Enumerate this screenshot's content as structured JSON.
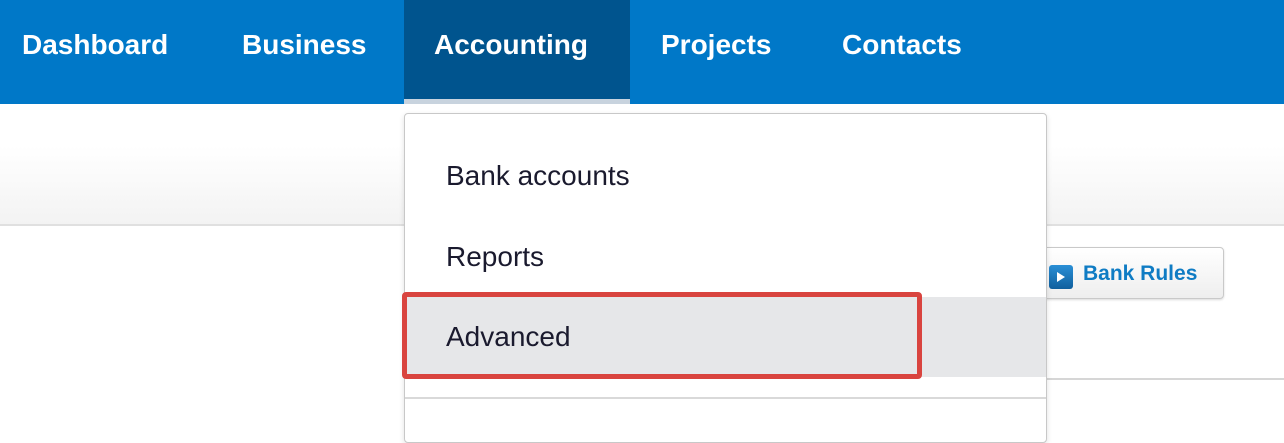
{
  "topnav": {
    "items": [
      {
        "label": "Dashboard"
      },
      {
        "label": "Business"
      },
      {
        "label": "Accounting"
      },
      {
        "label": "Projects"
      },
      {
        "label": "Contacts"
      }
    ],
    "active": "Accounting",
    "bg_color": "#0078c8",
    "active_bg_color": "#00548e"
  },
  "dropdown": {
    "items": [
      {
        "label": "Bank accounts"
      },
      {
        "label": "Reports"
      },
      {
        "label": "Advanced"
      }
    ],
    "hovered": "Advanced",
    "highlight_color": "#d9443f"
  },
  "toolbar": {
    "bank_rules_label": "Bank Rules",
    "bank_rules_icon": "play-icon"
  }
}
